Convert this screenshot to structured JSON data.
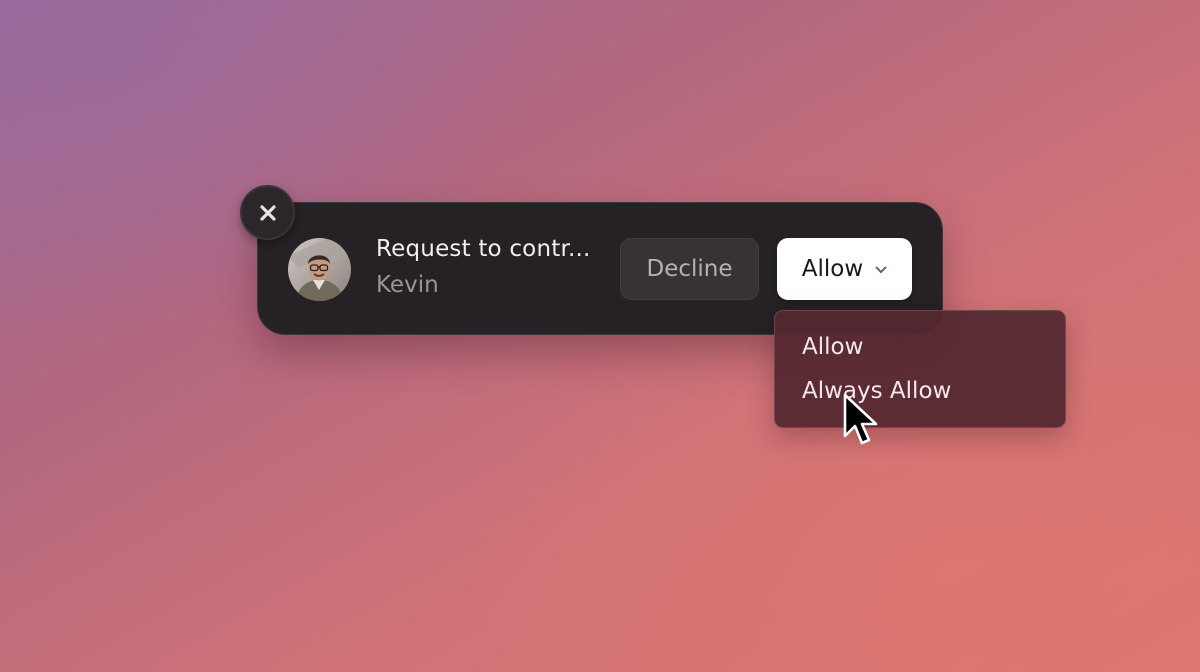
{
  "request": {
    "title": "Request to contr...",
    "requester": "Kevin"
  },
  "buttons": {
    "decline_label": "Decline",
    "allow_label": "Allow"
  },
  "dropdown": {
    "items": [
      {
        "label": "Allow"
      },
      {
        "label": "Always Allow"
      }
    ]
  },
  "icons": {
    "close": "close-icon",
    "chevron": "chevron-down-icon",
    "cursor": "mouse-pointer-icon"
  },
  "colors": {
    "panel_bg": "#252124",
    "allow_bg": "#ffffff",
    "decline_bg": "#363235",
    "dropdown_bg": "#542830"
  }
}
